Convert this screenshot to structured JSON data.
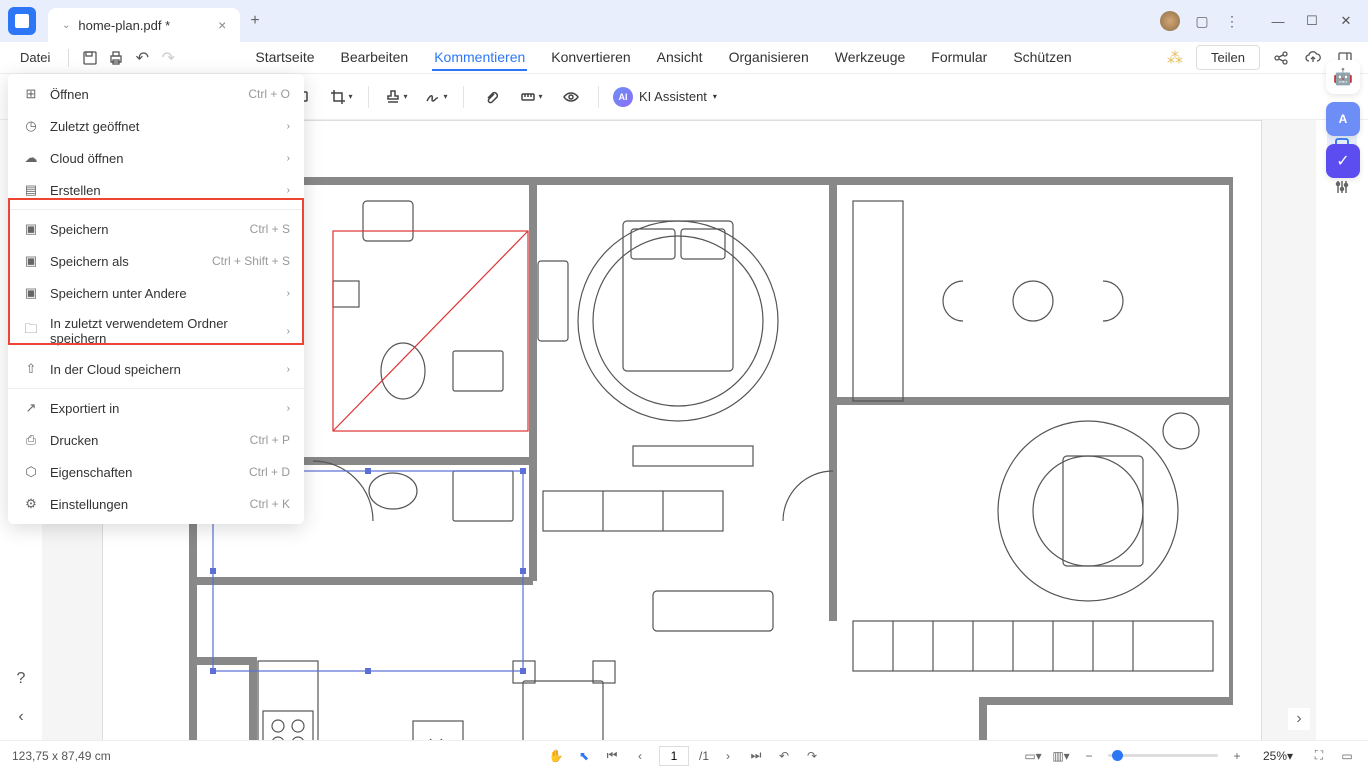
{
  "titlebar": {
    "tab_name": "home-plan.pdf *"
  },
  "menubar": {
    "file": "Datei",
    "tabs": [
      "Startseite",
      "Bearbeiten",
      "Kommentieren",
      "Konvertieren",
      "Ansicht",
      "Organisieren",
      "Werkzeuge",
      "Formular",
      "Schützen"
    ],
    "active_tab": "Kommentieren",
    "share": "Teilen"
  },
  "toolbar": {
    "ai_label": "KI Assistent"
  },
  "file_menu": {
    "items": [
      {
        "icon": "plus",
        "label": "Öffnen",
        "shortcut": "Ctrl + O",
        "arrow": false
      },
      {
        "icon": "clock",
        "label": "Zuletzt geöffnet",
        "shortcut": "",
        "arrow": true
      },
      {
        "icon": "cloud",
        "label": "Cloud öffnen",
        "shortcut": "",
        "arrow": true
      },
      {
        "icon": "doc",
        "label": "Erstellen",
        "shortcut": "",
        "arrow": true
      }
    ],
    "save_items": [
      {
        "icon": "save",
        "label": "Speichern",
        "shortcut": "Ctrl + S",
        "arrow": false
      },
      {
        "icon": "saveas",
        "label": "Speichern als",
        "shortcut": "Ctrl + Shift + S",
        "arrow": false
      },
      {
        "icon": "saveother",
        "label": "Speichern unter Andere",
        "shortcut": "",
        "arrow": true
      },
      {
        "icon": "folder",
        "label": "In zuletzt verwendetem Ordner speichern",
        "shortcut": "",
        "arrow": true
      },
      {
        "icon": "cloudup",
        "label": "In der Cloud speichern",
        "shortcut": "",
        "arrow": true
      }
    ],
    "bottom_items": [
      {
        "icon": "export",
        "label": "Exportiert in",
        "shortcut": "",
        "arrow": true
      },
      {
        "icon": "print",
        "label": "Drucken",
        "shortcut": "Ctrl + P",
        "arrow": false
      },
      {
        "icon": "props",
        "label": "Eigenschaften",
        "shortcut": "Ctrl + D",
        "arrow": false
      },
      {
        "icon": "settings",
        "label": "Einstellungen",
        "shortcut": "Ctrl + K",
        "arrow": false
      }
    ]
  },
  "statusbar": {
    "dimensions": "123,75 x 87,49 cm",
    "page_current": "1",
    "page_total": "/1",
    "zoom": "25%"
  }
}
